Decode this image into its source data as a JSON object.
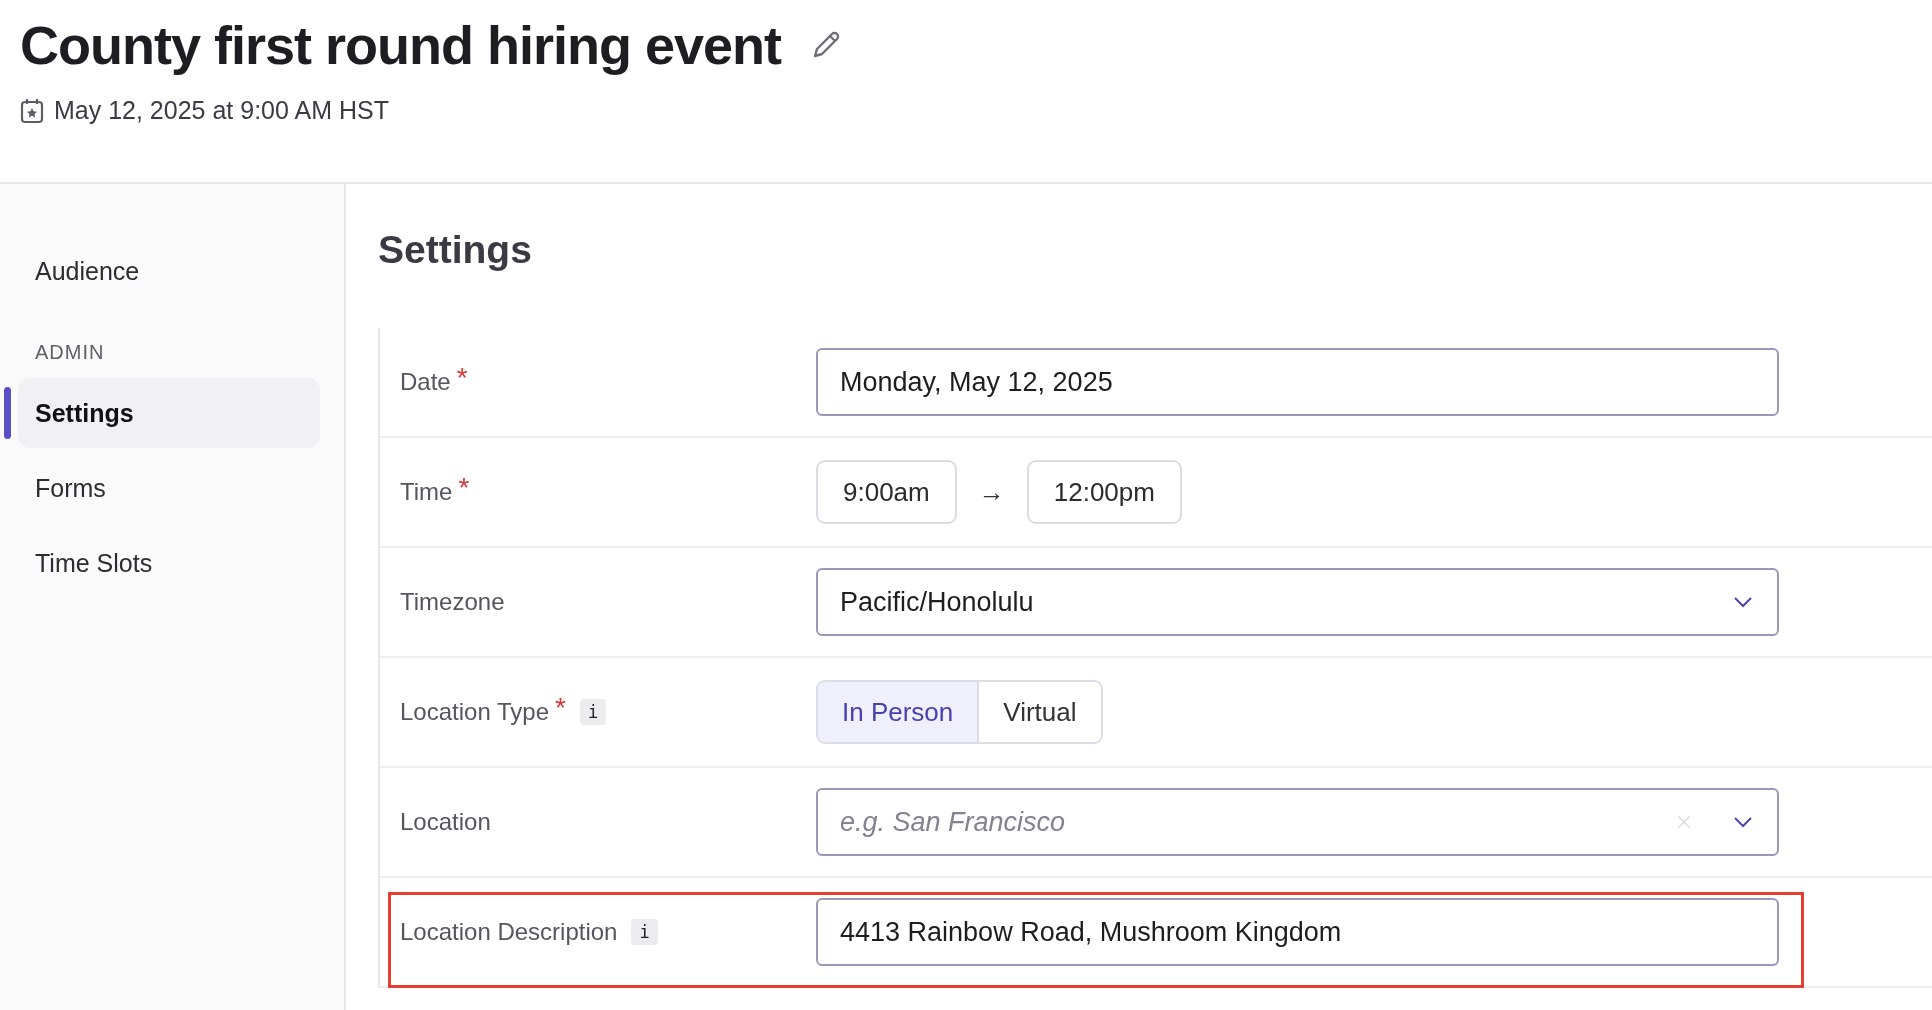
{
  "header": {
    "title": "County first round hiring event",
    "datetime": "May 12, 2025 at 9:00 AM HST"
  },
  "sidebar": {
    "items": [
      {
        "kind": "item",
        "label": "Audience",
        "selected": false
      },
      {
        "kind": "section",
        "label": "ADMIN"
      },
      {
        "kind": "item",
        "label": "Settings",
        "selected": true
      },
      {
        "kind": "item",
        "label": "Forms",
        "selected": false
      },
      {
        "kind": "item",
        "label": "Time Slots",
        "selected": false
      }
    ]
  },
  "settings": {
    "heading": "Settings",
    "rows": [
      {
        "kind": "text",
        "label": "Date",
        "required_mark": "*",
        "value": "Monday, May 12, 2025",
        "highlighted": false
      },
      {
        "kind": "time_range",
        "label": "Time",
        "required_mark": "*",
        "start": "9:00am",
        "arrow": "→",
        "end": "12:00pm",
        "highlighted": false
      },
      {
        "kind": "select",
        "label": "Timezone",
        "value": "Pacific/Honolulu",
        "highlighted": false
      },
      {
        "kind": "segmented",
        "label": "Location Type",
        "required_mark": "*",
        "info": "i",
        "options": [
          {
            "label": "In Person",
            "selected": true
          },
          {
            "label": "Virtual",
            "selected": false
          }
        ],
        "highlighted": false
      },
      {
        "kind": "combobox",
        "label": "Location",
        "placeholder": "e.g. San Francisco",
        "highlighted": false
      },
      {
        "kind": "text",
        "label": "Location Description",
        "info": "i",
        "value": "4413 Rainbow Road, Mushroom Kingdom",
        "highlighted": true
      }
    ]
  }
}
